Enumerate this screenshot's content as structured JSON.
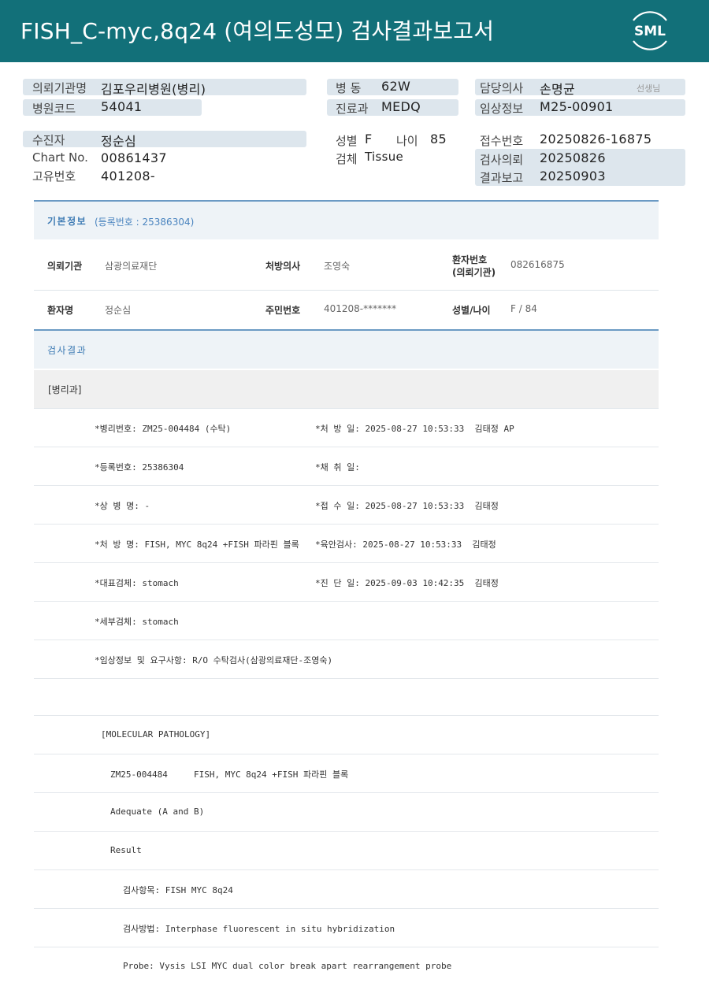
{
  "header": {
    "title": "FISH_C-myc,8q24  (여의도성모) 검사결과보고서",
    "logo_text": "SML",
    "bg_color": "#127079"
  },
  "info": {
    "institution_label": "의뢰기관명",
    "institution_value": "김포우리병원(병리)",
    "hospital_code_label": "병원코드",
    "hospital_code_value": "54041",
    "ward_label": "병 동",
    "ward_value": "62W",
    "dept_label": "진료과",
    "dept_value": "MEDQ",
    "doctor_label": "담당의사",
    "doctor_value": "손명균",
    "doctor_suffix": "선생님",
    "clinical_label": "임상정보",
    "clinical_value": "M25-00901",
    "patient_label": "수진자",
    "patient_value": "정순심",
    "chart_label": "Chart No.",
    "chart_value": "00861437",
    "unique_label": "고유번호",
    "unique_value": "401208-",
    "sex_label": "성별",
    "sex_value": "F",
    "age_label": "나이",
    "age_value": "85",
    "specimen_label": "검체",
    "specimen_value": "Tissue",
    "receipt_label": "접수번호",
    "receipt_value": "20250826-16875",
    "request_label": "검사의뢰",
    "request_value": "20250826",
    "report_label": "결과보고",
    "report_value": "20250903"
  },
  "basic": {
    "title": "기본정보",
    "sub": "(등록번호 : 25386304)",
    "inst_label": "의뢰기관",
    "inst_value": "삼광의료재단",
    "rx_doctor_label": "처방의사",
    "rx_doctor_value": "조영숙",
    "pt_no_label_1": "환자번호",
    "pt_no_label_2": "(의뢰기관)",
    "pt_no_value": "082616875",
    "pt_name_label": "환자명",
    "pt_name_value": "정순심",
    "rrn_label": "주민번호",
    "rrn_value": "401208-*******",
    "sex_age_label": "성별/나이",
    "sex_age_value": "F / 84"
  },
  "results": {
    "title": "검사결과",
    "dept": "[병리과]",
    "lines": [
      {
        "left": "*병리번호: ZM25-004484 (수탁)",
        "right": "*처 방 일: 2025-08-27 10:53:33  김태정 AP"
      },
      {
        "left": "*등록번호: 25386304",
        "right": "*채 취 일:"
      },
      {
        "left": "*상 병 명: -",
        "right": "*접 수 일: 2025-08-27 10:53:33  김태정"
      },
      {
        "left": "*처 방 명: FISH, MYC 8q24 +FISH 파라핀 블록",
        "right": "*육안검사: 2025-08-27 10:53:33  김태정"
      },
      {
        "left": "*대표검체: stomach",
        "right": "*진 단 일: 2025-09-03 10:42:35  김태정"
      },
      {
        "left": "*세부검체: stomach",
        "right": ""
      },
      {
        "left": "*임상정보 및 요구사항: R/O 수탁검사(삼광의료재단-조영숙)",
        "right": ""
      }
    ],
    "mol_heading": "[MOLECULAR PATHOLOGY]",
    "mol_line1": "ZM25-004484     FISH, MYC 8q24 +FISH 파라핀 블록",
    "mol_line2": "Adequate (A and B)",
    "mol_line3": "Result",
    "mol_line4": "검사항목: FISH MYC 8q24",
    "mol_line5": "검사방법: Interphase fluorescent in situ hybridization",
    "mol_line6": "Probe: Vysis LSI MYC dual color break apart rearrangement probe"
  }
}
